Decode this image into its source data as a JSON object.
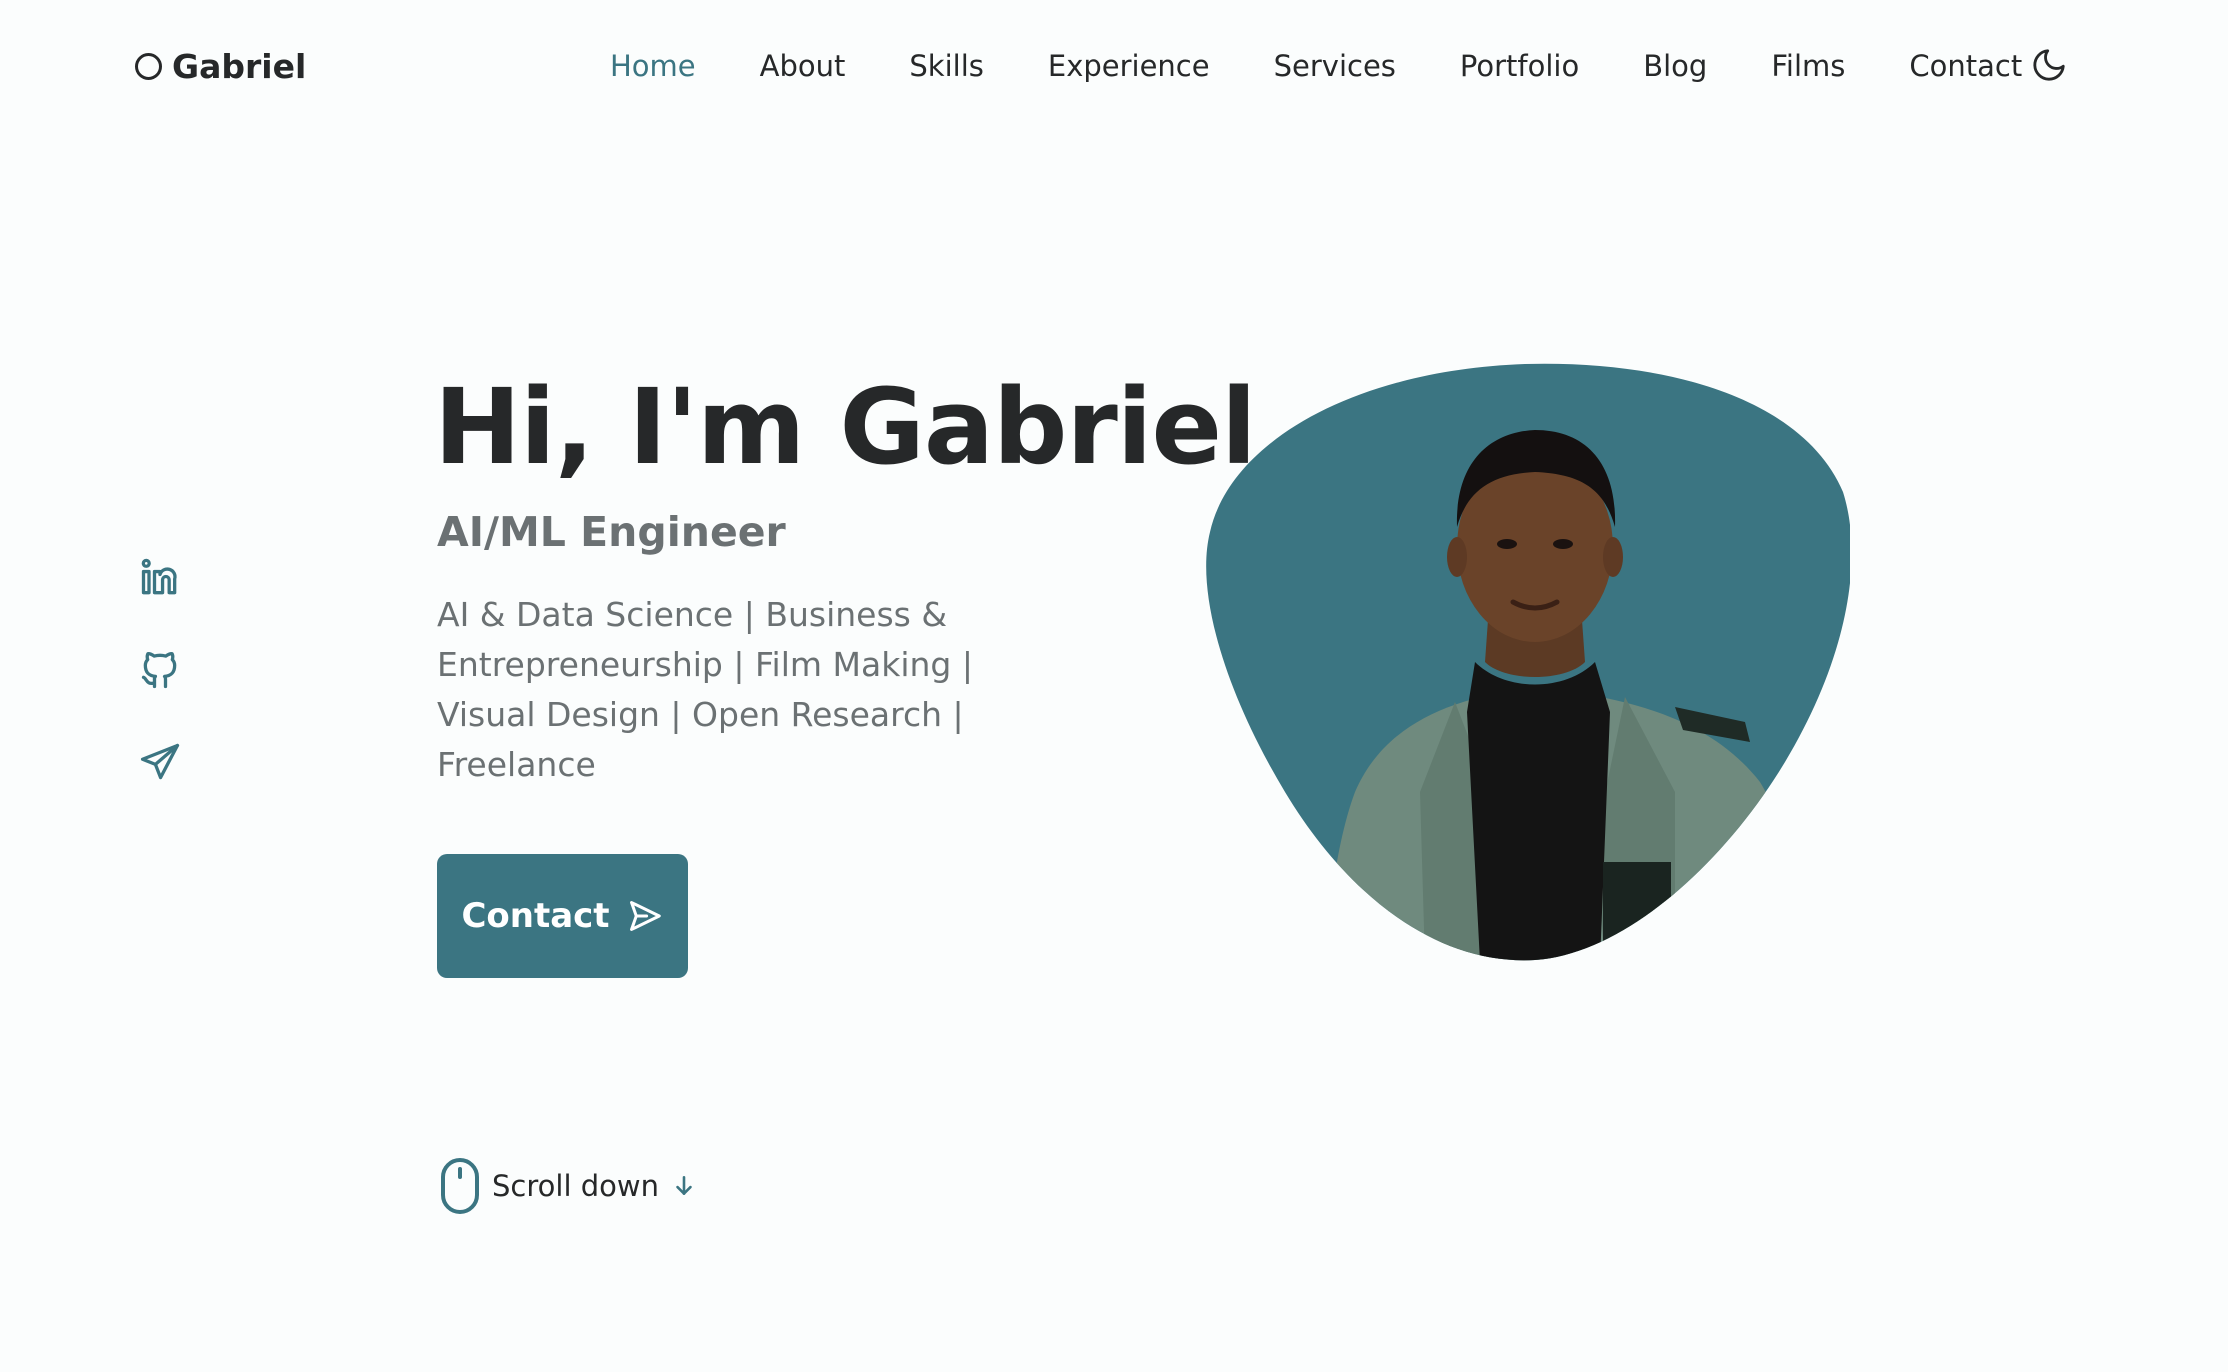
{
  "header": {
    "logo_text": "Gabriel",
    "nav": [
      {
        "label": "Home",
        "active": true
      },
      {
        "label": "About"
      },
      {
        "label": "Skills"
      },
      {
        "label": "Experience"
      },
      {
        "label": "Services"
      },
      {
        "label": "Portfolio"
      },
      {
        "label": "Blog"
      },
      {
        "label": "Films"
      },
      {
        "label": "Contact"
      }
    ],
    "theme_toggle_icon": "moon-icon"
  },
  "social": {
    "items": [
      {
        "icon": "linkedin-icon"
      },
      {
        "icon": "github-icon"
      },
      {
        "icon": "telegram-icon"
      }
    ]
  },
  "hero": {
    "title": "Hi, I'm Gabriel",
    "subtitle": "AI/ML Engineer",
    "description": "AI & Data Science | Business & Entrepreneurship | Film Making | Visual Design | Open Research | Freelance",
    "contact_button": "Contact",
    "contact_button_icon": "send-icon",
    "scroll_label": "Scroll down",
    "scroll_icons": [
      "mouse-icon",
      "arrow-down-icon"
    ]
  },
  "colors": {
    "accent": "#3b7582",
    "text": "#262829",
    "muted_text": "#6b7173",
    "background": "#fbfdfd"
  }
}
